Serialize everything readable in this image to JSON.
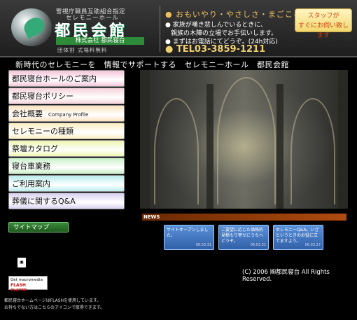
{
  "header": {
    "logo_top": "警視庁職員互助組合指定",
    "logo_sub": "セレモニーホール",
    "logo_main": "都民会館",
    "logo_company": "株式会社 都民寝台",
    "logo_bottom": "団体割 式場料無料",
    "tagline": "● おもいやり・やさしさ・まごころ",
    "bullet1": "● 家族が嘆き悲しんでいるときに、",
    "bullet1b": "親族の木陣の立場でお手伝いします。",
    "bullet2": "● まずはお電話にてどうぞ。(24h対応)",
    "phone": "● TEL03-3859-1211",
    "staff_button_line1": "スタッフが",
    "staff_button_line2": "すぐにお伺い致します"
  },
  "subtitle": "新時代のセレモニーを　情報でサポートする　セレモニーホール　都民会館",
  "menu": [
    {
      "label": "都民寝台ホールのご案内",
      "sub": "",
      "color": "#f4c4d8"
    },
    {
      "label": "都民寝台ポリシー",
      "sub": "",
      "color": "#f6d2dc"
    },
    {
      "label": "会社概要",
      "sub": "Company Profile",
      "color": "#fbe2c0"
    },
    {
      "label": "セレモニーの種類",
      "sub": "",
      "color": "#fbeec0"
    },
    {
      "label": "祭壇カタログ",
      "sub": "",
      "color": "#eef4b0"
    },
    {
      "label": "寝台車業務",
      "sub": "",
      "color": "#c8f0c8"
    },
    {
      "label": "ご利用案内",
      "sub": "",
      "color": "#b8ecec"
    },
    {
      "label": "葬儀に関するQ&A",
      "sub": "",
      "color": "#d8d0f0"
    }
  ],
  "sitemap_label": "サイトマップ",
  "news": {
    "label": "NEWS",
    "items": [
      {
        "text": "サイトオープンしました。",
        "date": "06.03.31"
      },
      {
        "text": "ご要望に応じた価格的見積もり寄せにうちへどうぞ。",
        "date": "06.03.31"
      },
      {
        "text": "セレモニーQ&A。いざというときのお役に立てますよう。",
        "date": "06.03.27"
      }
    ]
  },
  "footer": {
    "copyright": "(C) 2006 ㈱都民寝台 All Rights Reserved.",
    "flash_line1": "Get macromedia",
    "flash_line2": "FLASH",
    "flash_line3": "PLAYER",
    "note1": "都民寝台ホームページはFLASHを使用しています。",
    "note2": "お持ちでない方はこちらのアイコンで取得できます。"
  },
  "colors": {
    "accent_gold": "#f0d070",
    "news_bar": "#b04a10",
    "sitemap_green": "#2e7a2e"
  }
}
